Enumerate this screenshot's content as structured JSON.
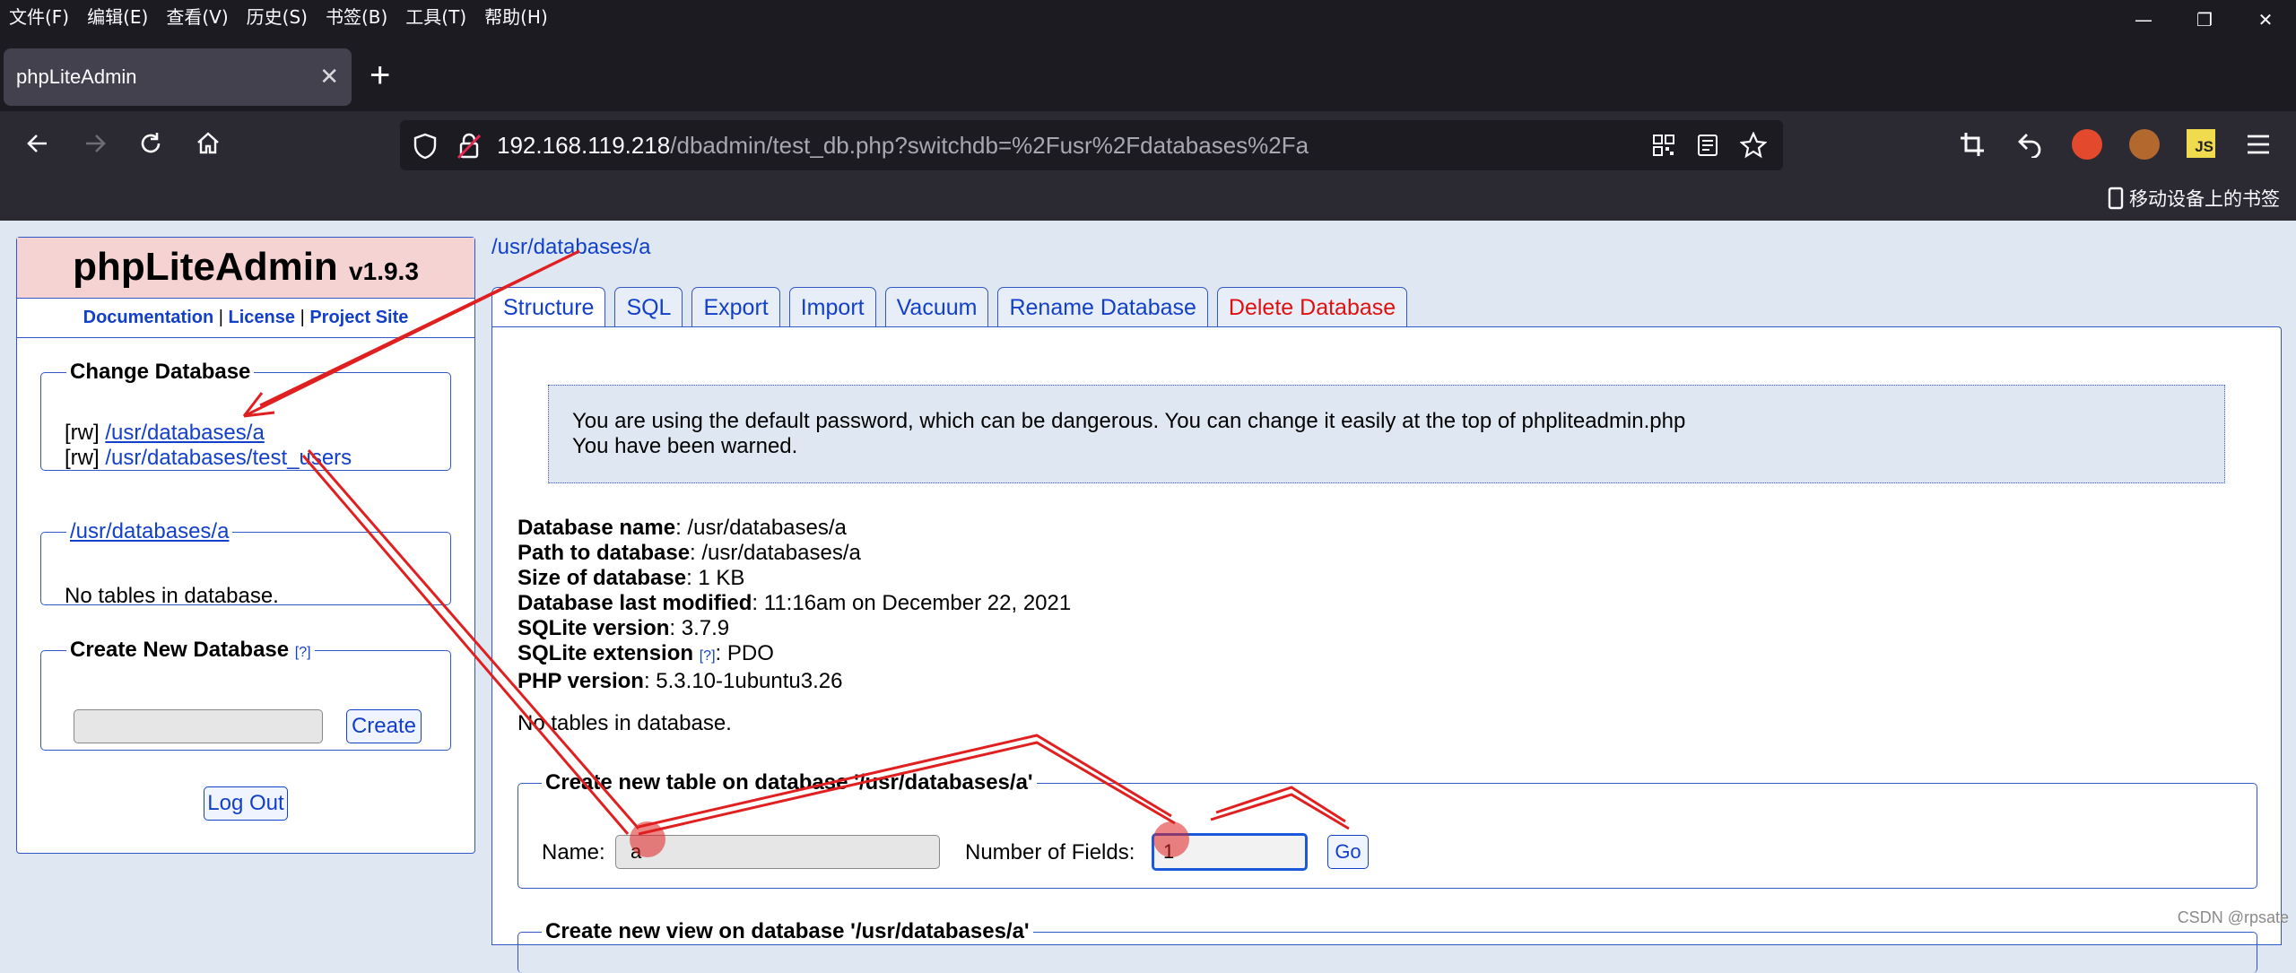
{
  "menubar": {
    "items": [
      "文件(F)",
      "编辑(E)",
      "查看(V)",
      "历史(S)",
      "书签(B)",
      "工具(T)",
      "帮助(H)"
    ]
  },
  "window_controls": {
    "minimize": "—",
    "restore": "❐",
    "close": "✕"
  },
  "browser": {
    "tab_title": "phpLiteAdmin",
    "tab_close": "✕",
    "new_tab": "+",
    "url_host": "192.168.119.218",
    "url_path": "/dbadmin/test_db.php?switchdb=%2Fusr%2Fdatabases%2Fa",
    "mobile_bookmarks": "移动设备上的书签",
    "js_icon_label": "JS"
  },
  "sidebar": {
    "app_name": "phpLiteAdmin",
    "version": "v1.9.3",
    "links": {
      "documentation": "Documentation",
      "license": "License",
      "project_site": "Project Site",
      "sep": "|"
    },
    "change_db": {
      "legend": "Change Database",
      "items": [
        {
          "mode": "[rw]",
          "path": "/usr/databases/a"
        },
        {
          "mode": "[rw]",
          "path": "/usr/databases/test_users"
        }
      ]
    },
    "current_db": {
      "legend": "/usr/databases/a",
      "text": "No tables in database."
    },
    "create_db": {
      "legend": "Create New Database",
      "help": "[?]",
      "input_value": "",
      "button": "Create"
    },
    "logout": "Log Out"
  },
  "main": {
    "breadcrumb": "/usr/databases/a",
    "tabs": [
      "Structure",
      "SQL",
      "Export",
      "Import",
      "Vacuum",
      "Rename Database",
      "Delete Database"
    ],
    "active_tab": "Structure",
    "warning_lines": [
      "You are using the default password, which can be dangerous. You can change it easily at the top of phpliteadmin.php",
      "You have been warned."
    ],
    "info": [
      {
        "label": "Database name",
        "value": ": /usr/databases/a"
      },
      {
        "label": "Path to database",
        "value": ": /usr/databases/a"
      },
      {
        "label": "Size of database",
        "value": ": 1 KB"
      },
      {
        "label": "Database last modified",
        "value": ": 11:16am on December 22, 2021"
      },
      {
        "label": "SQLite version",
        "value": ": 3.7.9"
      },
      {
        "label": "SQLite extension",
        "value": ": PDO",
        "help": "[?]"
      },
      {
        "label": "PHP version",
        "value": ": 5.3.10-1ubuntu3.26"
      }
    ],
    "no_tables": "No tables in database.",
    "create_table": {
      "legend": "Create new table on database '/usr/databases/a'",
      "name_label": "Name:",
      "name_value": "a",
      "fields_label": "Number of Fields:",
      "fields_value": "1",
      "go": "Go"
    },
    "create_view_legend": "Create new view on database '/usr/databases/a'"
  },
  "watermark": "CSDN @rpsate",
  "colors": {
    "link": "#1340c8",
    "danger": "#e01010",
    "annotation": "#e02020",
    "logo_bg": "#f5d3d3"
  }
}
